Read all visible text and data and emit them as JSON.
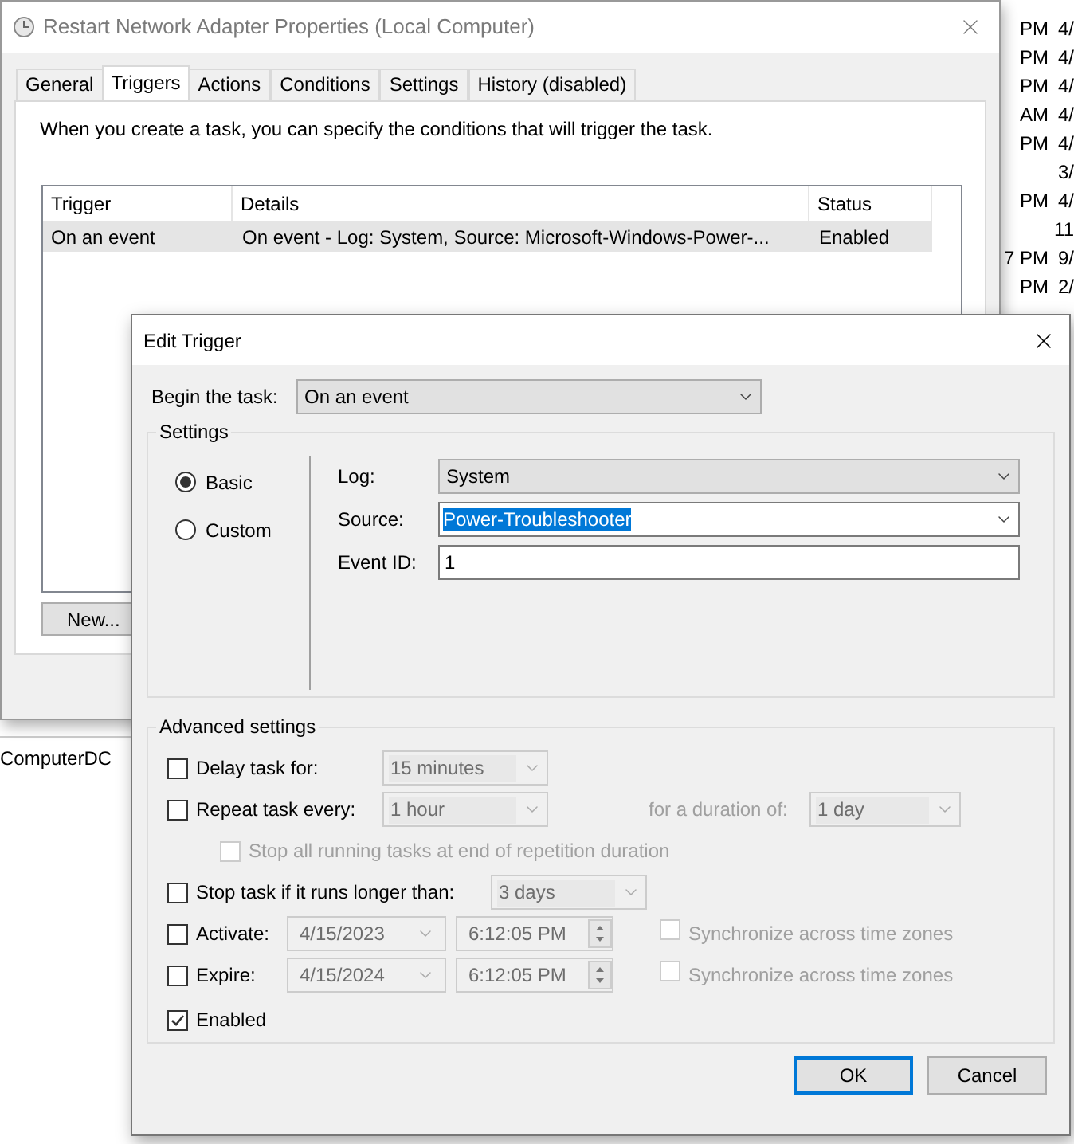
{
  "background_list": {
    "rows": [
      {
        "column_1": "PM",
        "column_2": "4/"
      },
      {
        "column_1": "PM",
        "column_2": "4/"
      },
      {
        "column_1": "PM",
        "column_2": "4/"
      },
      {
        "column_1": "AM",
        "column_2": "4/"
      },
      {
        "column_1": "PM",
        "column_2": "4/"
      },
      {
        "column_2": "3/"
      },
      {
        "column_1": "PM",
        "column_2": "4/"
      },
      {
        "column_2": "11"
      },
      {
        "column_1": "7 PM",
        "column_2": "9/"
      },
      {
        "column_1": "PM",
        "column_2": "2/"
      }
    ],
    "computer_label": "ComputerDC"
  },
  "properties_window": {
    "title": "Restart Network Adapter Properties (Local Computer)",
    "tabs": [
      {
        "label": "General",
        "selected": false
      },
      {
        "label": "Triggers",
        "selected": true
      },
      {
        "label": "Actions",
        "selected": false
      },
      {
        "label": "Conditions",
        "selected": false
      },
      {
        "label": "Settings",
        "selected": false
      },
      {
        "label": "History (disabled)",
        "selected": false
      }
    ],
    "description": "When you create a task, you can specify the conditions that will trigger the task.",
    "table": {
      "columns": [
        "Trigger",
        "Details",
        "Status"
      ],
      "rows": [
        {
          "trigger": "On an event",
          "details": "On event - Log: System, Source: Microsoft-Windows-Power-...",
          "status": "Enabled",
          "selected": true
        }
      ]
    },
    "new_button": "New..."
  },
  "edit_trigger": {
    "title": "Edit Trigger",
    "begin_label": "Begin the task:",
    "begin_value": "On an event",
    "settings_label": "Settings",
    "radios": [
      {
        "label": "Basic",
        "selected": true
      },
      {
        "label": "Custom",
        "selected": false
      }
    ],
    "fields": [
      {
        "label": "Log:",
        "value": "System",
        "kind": "dropdown",
        "text_selected": false
      },
      {
        "label": "Source:",
        "value": "Power-Troubleshooter",
        "kind": "combo",
        "text_selected": true
      },
      {
        "label": "Event ID:",
        "value": "1",
        "kind": "text",
        "text_selected": false
      }
    ],
    "advanced_label": "Advanced settings",
    "delay": {
      "label": "Delay task for:",
      "checked": false,
      "value": "15 minutes",
      "disabled": true
    },
    "repeat": {
      "label": "Repeat task every:",
      "checked": false,
      "value": "1 hour",
      "disabled": true,
      "duration_label": "for a duration of:",
      "duration_value": "1 day"
    },
    "stop_all": {
      "label": "Stop all running tasks at end of repetition duration",
      "checked": false,
      "disabled": true
    },
    "stop_task": {
      "label": "Stop task if it runs longer than:",
      "checked": false,
      "value": "3 days",
      "disabled": true
    },
    "dates": [
      {
        "label": "Activate:",
        "checked": false,
        "date": "4/15/2023",
        "time": "6:12:05 PM",
        "sync_label": "Synchronize across time zones",
        "sync_checked": false,
        "disabled": true
      },
      {
        "label": "Expire:",
        "checked": false,
        "date": "4/15/2024",
        "time": "6:12:05 PM",
        "sync_label": "Synchronize across time zones",
        "sync_checked": false,
        "disabled": true
      }
    ],
    "enabled": {
      "label": "Enabled",
      "checked": true
    },
    "buttons": [
      {
        "label": "OK",
        "default": true
      },
      {
        "label": "Cancel",
        "default": false
      }
    ]
  }
}
